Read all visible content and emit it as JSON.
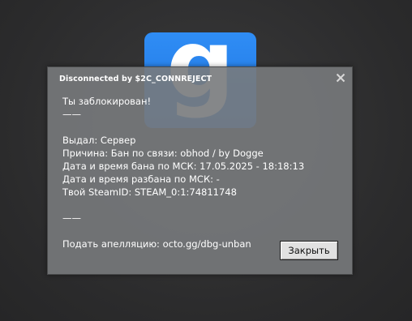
{
  "background": {
    "color": "#2d2d2e"
  },
  "logo": {
    "letter": "g",
    "color": "#2a87f0",
    "icon": "gmod-logo-icon"
  },
  "dialog": {
    "title": "Disconnected by $2C_CONNREJECT",
    "close_icon": "close-icon",
    "lines": {
      "blocked": "Ты заблокирован!",
      "separator1": "——",
      "issued_by": "Выдал: Сервер",
      "reason": "Причина: Бан по связи: obhod / by Dogge",
      "ban_datetime": "Дата и время бана по МСК: 17.05.2025 - 18:18:13",
      "unban_datetime": "Дата и время разбана по МСК: -",
      "steam_id": "Твой SteamID: STEAM_0:1:74811748",
      "separator2": "——",
      "appeal": "Подать апелляцию: octo.gg/dbg-unban"
    },
    "close_button_label": "Закрыть"
  }
}
